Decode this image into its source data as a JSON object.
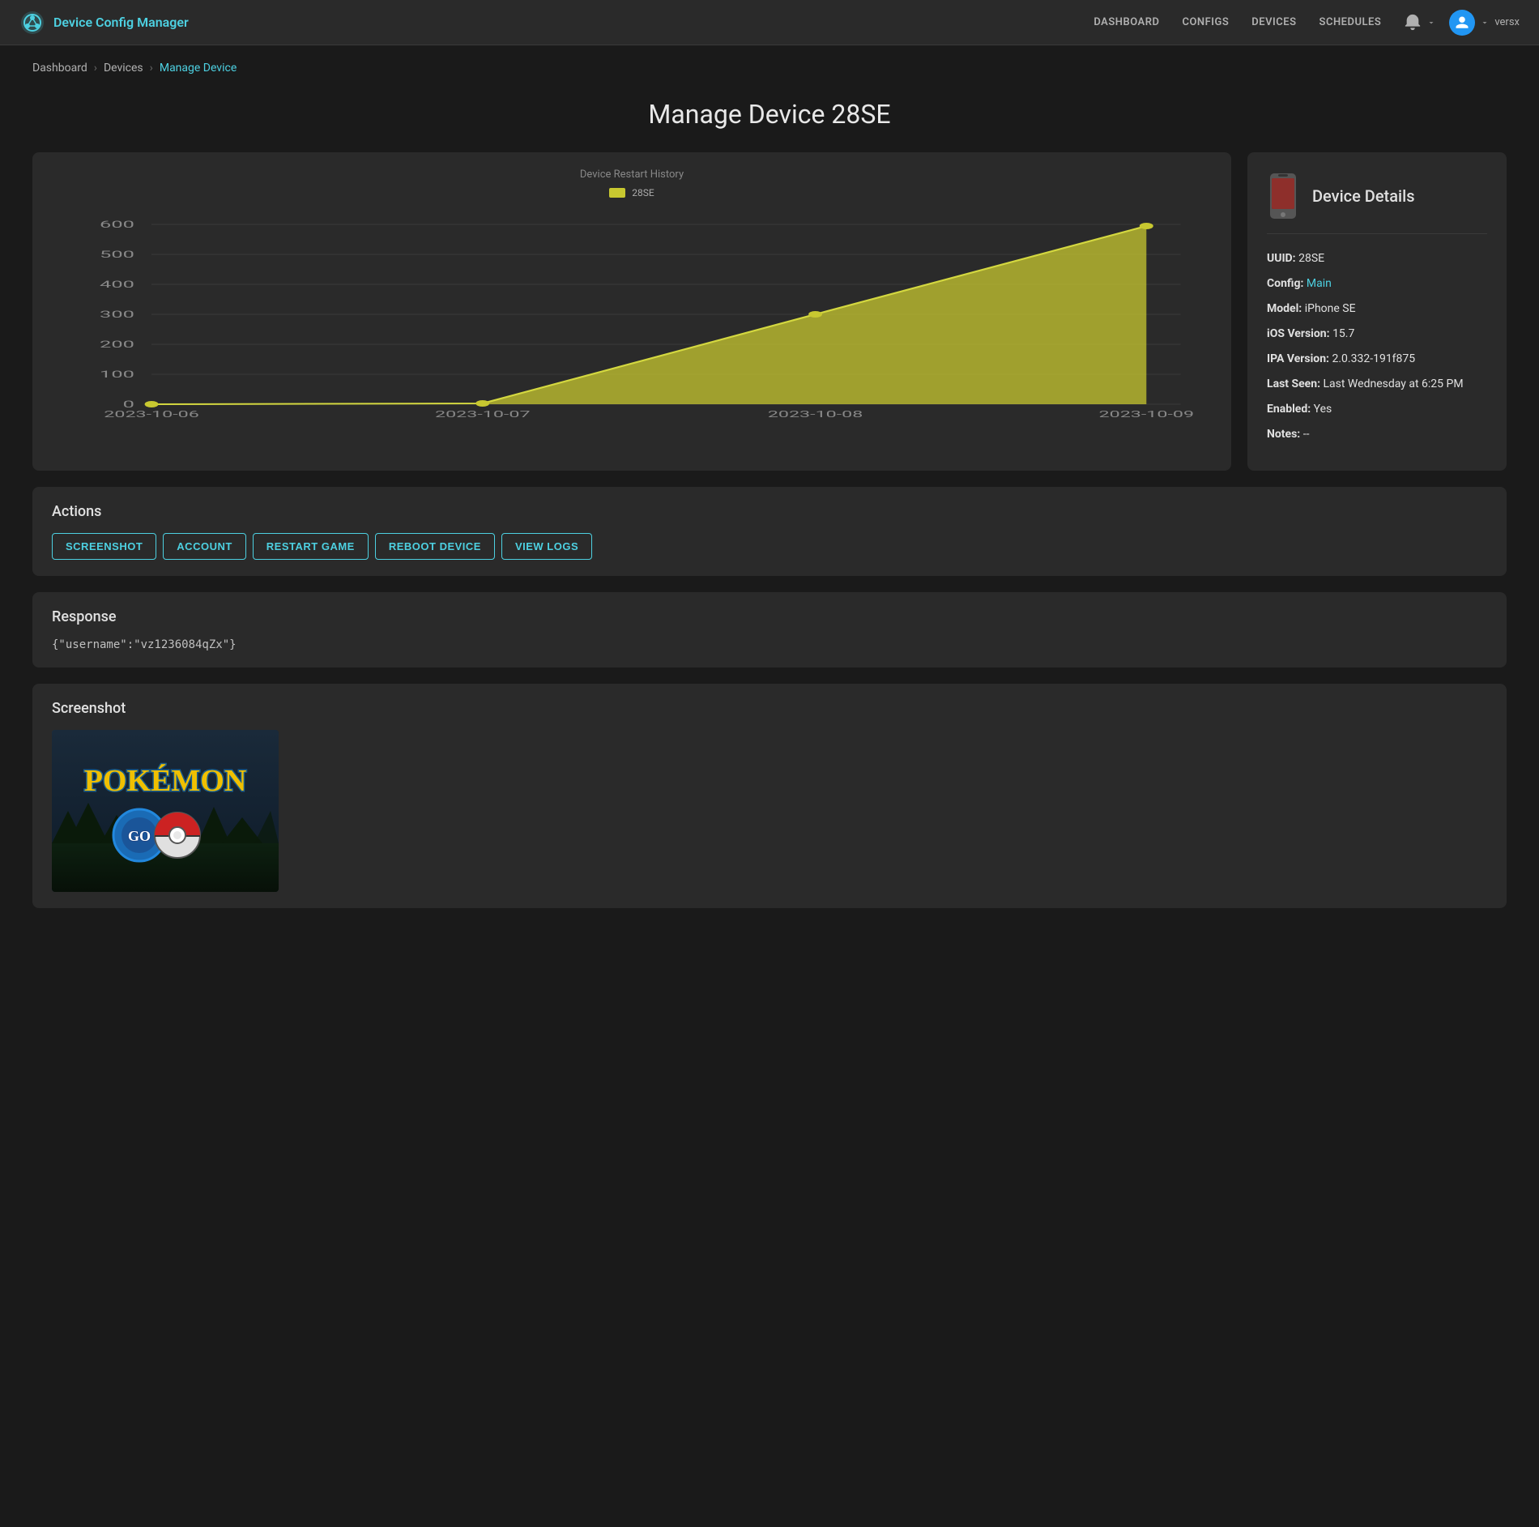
{
  "navbar": {
    "brand": "Device Config Manager",
    "nav_links": [
      "DASHBOARD",
      "CONFIGS",
      "DEVICES",
      "SCHEDULES"
    ],
    "username": "versx"
  },
  "breadcrumb": {
    "items": [
      "Dashboard",
      "Devices",
      "Manage Device"
    ]
  },
  "page": {
    "title": "Manage Device 28SE"
  },
  "chart": {
    "title": "Device Restart History",
    "legend_label": "28SE",
    "y_labels": [
      "600",
      "500",
      "400",
      "300",
      "200",
      "100",
      "0"
    ],
    "x_labels": [
      "2023-10-06",
      "2023-10-07",
      "2023-10-08",
      "2023-10-09"
    ]
  },
  "device_details": {
    "title": "Device Details",
    "fields": [
      {
        "label": "UUID:",
        "value": "28SE",
        "accent": false
      },
      {
        "label": "Config:",
        "value": "Main",
        "accent": true
      },
      {
        "label": "Model:",
        "value": "iPhone SE",
        "accent": false
      },
      {
        "label": "iOS Version:",
        "value": "15.7",
        "accent": false
      },
      {
        "label": "IPA Version:",
        "value": "2.0.332-191f875",
        "accent": false
      },
      {
        "label": "Last Seen:",
        "value": "Last Wednesday at 6:25 PM",
        "accent": false
      },
      {
        "label": "Enabled:",
        "value": "Yes",
        "accent": false
      },
      {
        "label": "Notes:",
        "value": "--",
        "accent": false
      }
    ]
  },
  "actions": {
    "title": "Actions",
    "buttons": [
      "SCREENSHOT",
      "ACCOUNT",
      "RESTART GAME",
      "REBOOT DEVICE",
      "VIEW LOGS"
    ]
  },
  "response": {
    "title": "Response",
    "text": "{\"username\":\"vz1236084qZx\"}"
  },
  "screenshot": {
    "title": "Screenshot"
  }
}
